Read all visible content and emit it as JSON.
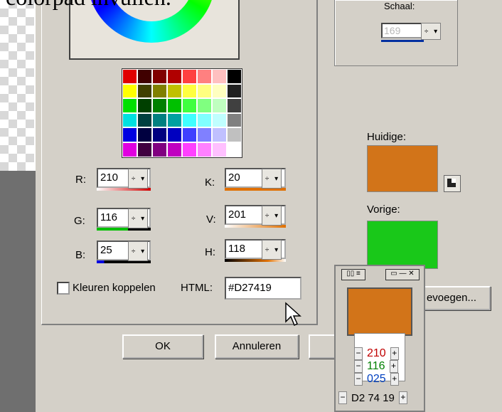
{
  "caption": "colorpad invullen.",
  "scale": {
    "label": "Schaal:",
    "value": "169"
  },
  "channels": {
    "r": {
      "label": "R:",
      "value": "210"
    },
    "g": {
      "label": "G:",
      "value": "116"
    },
    "b": {
      "label": "B:",
      "value": "25"
    },
    "k": {
      "label": "K:",
      "value": "20"
    },
    "v": {
      "label": "V:",
      "value": "201"
    },
    "h": {
      "label": "H:",
      "value": "118"
    }
  },
  "link_colors_label": "Kleuren koppelen",
  "html": {
    "label": "HTML:",
    "value": "#D27419"
  },
  "current": {
    "label": "Huidige:",
    "color": "#d27419"
  },
  "previous": {
    "label": "Vorige:",
    "color": "#19c819"
  },
  "buttons": {
    "ok": "OK",
    "cancel": "Annuleren",
    "add": "evoegen..."
  },
  "mini_panel": {
    "r": "210",
    "g": "116",
    "b": "025",
    "hex": "D2 74 19",
    "minus": "−",
    "plus": "+"
  },
  "palette": [
    [
      "#e00000",
      "#400000",
      "#800000",
      "#b00000",
      "#ff4040",
      "#ff8080",
      "#ffc0c0",
      "#000000"
    ],
    [
      "#ffff00",
      "#404000",
      "#808000",
      "#c0c000",
      "#ffff40",
      "#ffff80",
      "#ffffc0",
      "#202020"
    ],
    [
      "#00e000",
      "#004000",
      "#008000",
      "#00c000",
      "#40ff40",
      "#80ff80",
      "#c0ffc0",
      "#404040"
    ],
    [
      "#00e0e0",
      "#004040",
      "#008080",
      "#00a0a0",
      "#40ffff",
      "#80ffff",
      "#c0ffff",
      "#808080"
    ],
    [
      "#0000e0",
      "#000040",
      "#000080",
      "#0000c0",
      "#4040ff",
      "#8080ff",
      "#c0c0ff",
      "#c0c0c0"
    ],
    [
      "#e000e0",
      "#400040",
      "#800080",
      "#c000c0",
      "#ff40ff",
      "#ff80ff",
      "#ffc0ff",
      "#ffffff"
    ]
  ]
}
